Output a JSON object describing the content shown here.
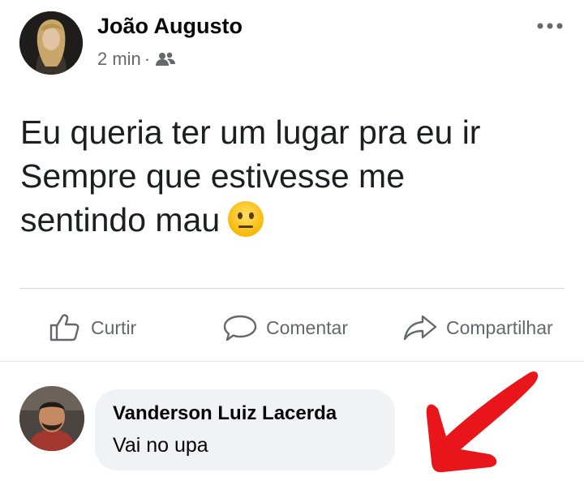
{
  "post": {
    "author_name": "João Augusto",
    "time": "2 min",
    "separator": "·",
    "audience_icon": "friends-icon",
    "more_icon": "more-options-icon",
    "text_lines": [
      "Eu queria ter um lugar pra eu ir",
      "Sempre que estivesse me",
      "sentindo mau"
    ],
    "emoji": "neutral-face"
  },
  "actions": {
    "like_label": "Curtir",
    "comment_label": "Comentar",
    "share_label": "Compartilhar"
  },
  "comment": {
    "author_name": "Vanderson Luiz Lacerda",
    "text": "Vai no upa"
  },
  "colors": {
    "secondary_text": "#65676b",
    "comment_bubble": "#f0f2f5",
    "annotation_arrow": "#e8161b"
  }
}
